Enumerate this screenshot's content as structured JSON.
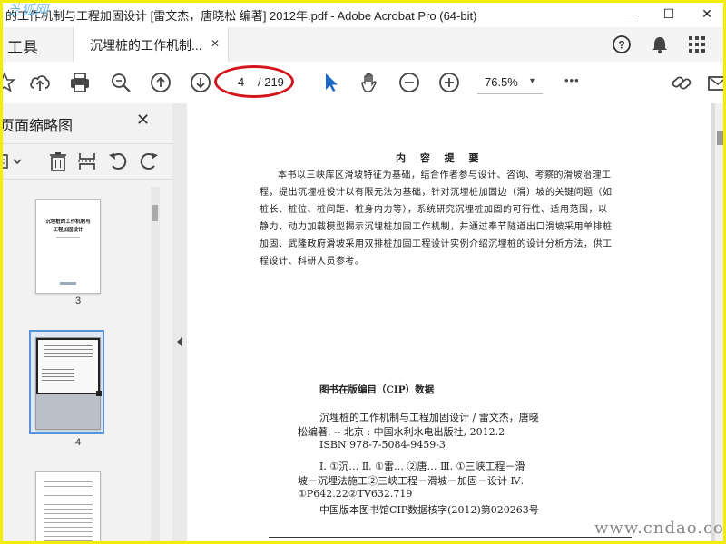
{
  "window": {
    "title": "的工作机制与工程加固设计 [雷文杰，唐晓松 编著] 2012年.pdf - Adobe Acrobat Pro (64-bit)",
    "watermark": "芝狐网",
    "controls": {
      "minimize": "—",
      "maximize": "☐",
      "close": "✕"
    }
  },
  "tabs": {
    "tools_label": "工具",
    "document_label": "沉埋桩的工作机制...",
    "close_glyph": "✕"
  },
  "toolbar": {
    "page_current": "4",
    "page_total": "/ 219",
    "zoom": "76.5%",
    "zoom_caret": "▾",
    "more": "•••",
    "highlight_color": "#d4161c"
  },
  "sidebar": {
    "title": "页面缩略图",
    "close_glyph": "✕",
    "thumbs": [
      {
        "page": "3",
        "title1": "沉埋桩的工作机制与",
        "title2": "工程加固设计"
      },
      {
        "page": "4"
      },
      {
        "page": ""
      }
    ],
    "accent": "#1976d2"
  },
  "document": {
    "content_title": "内 容 提 要",
    "summary": "本书以三峡库区滑坡特征为基础，结合作者参与设计、咨询、考察的滑坡治理工程，提出沉埋桩设计以有限元法为基础，针对沉埋桩加固边（滑）坡的关键问题（如桩长、桩位、桩间距、桩身内力等），系统研究沉埋桩加固的可行性、适用范围，以静力、动力加载模型揭示沉埋桩加固工作机制，并通过奉节隧道出口滑坡采用单排桩加固、武隆政府滑坡采用双排桩加固工程设计实例介绍沉埋桩的设计分析方法，供工程设计、科研人员参考。",
    "cip_title": "图书在版编目（CIP）数据",
    "cip_lines": [
      "沉埋桩的工作机制与工程加固设计 / 雷文杰，唐晓",
      "松编著. -- 北京 : 中国水利水电出版社, 2012.2",
      "ISBN 978-7-5084-9459-3",
      "Ⅰ. ①沉… Ⅱ. ①雷… ②唐… Ⅲ. ①三峡工程－滑",
      "坡－沉埋法施工②三峡工程－滑坡－加固－设计 Ⅳ.",
      "①P642.22②TV632.719"
    ],
    "cip_note": "中国版本图书馆CIP数据核字(2012)第020263号"
  },
  "site_watermark": "www.cndao.com"
}
